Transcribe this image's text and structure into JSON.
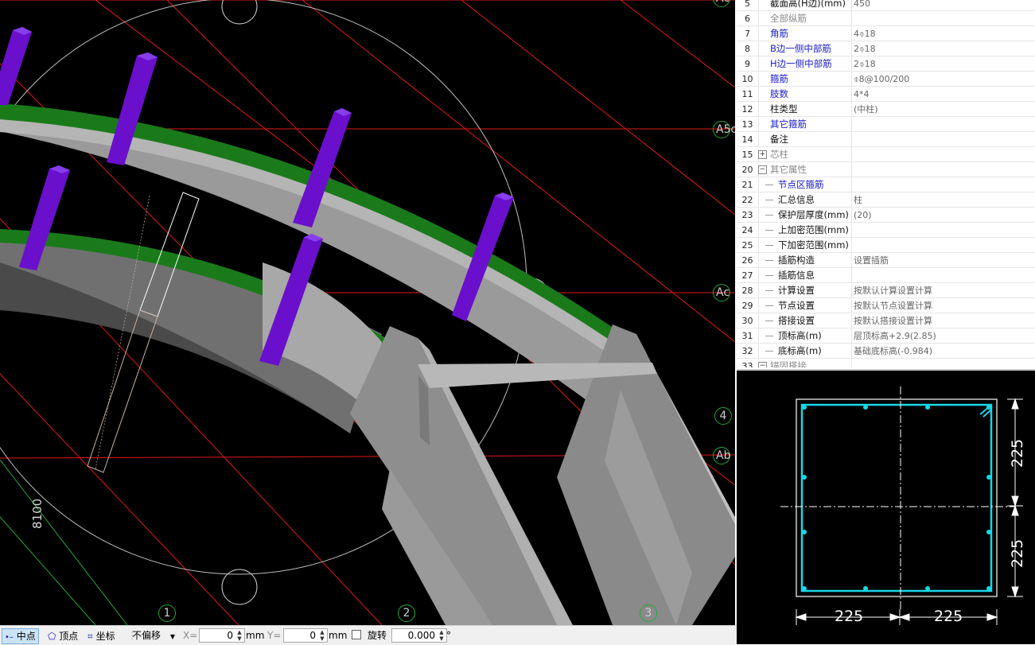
{
  "axis_labels": {
    "a5c": "A5c",
    "ac": "Ac",
    "ab": "Ab",
    "top_right": "Ac",
    "num_1": "1",
    "num_2": "2",
    "num_3": "3",
    "num_4": "4"
  },
  "dimension_text": "8100",
  "properties": [
    {
      "num": "5",
      "name": "截面高(H边)(mm)",
      "value": "450",
      "color": "black",
      "kind": "plain"
    },
    {
      "num": "6",
      "name": "全部纵筋",
      "value": "",
      "color": "gray",
      "kind": "plain"
    },
    {
      "num": "7",
      "name": "角筋",
      "value": "4⌽18",
      "color": "blue",
      "kind": "plain"
    },
    {
      "num": "8",
      "name": "B边一侧中部筋",
      "value": "2⌽18",
      "color": "blue",
      "kind": "plain"
    },
    {
      "num": "9",
      "name": "H边一侧中部筋",
      "value": "2⌽18",
      "color": "blue",
      "kind": "plain"
    },
    {
      "num": "10",
      "name": "箍筋",
      "value": "⌽8@100/200",
      "color": "blue",
      "kind": "plain"
    },
    {
      "num": "11",
      "name": "肢数",
      "value": "4*4",
      "color": "blue",
      "kind": "plain"
    },
    {
      "num": "12",
      "name": "柱类型",
      "value": "(中柱)",
      "color": "black",
      "kind": "plain"
    },
    {
      "num": "13",
      "name": "其它箍筋",
      "value": "",
      "color": "blue",
      "kind": "plain"
    },
    {
      "num": "14",
      "name": "备注",
      "value": "",
      "color": "black",
      "kind": "plain"
    },
    {
      "num": "15",
      "name": "芯柱",
      "value": "",
      "color": "gray",
      "kind": "group",
      "expander": "+"
    },
    {
      "num": "20",
      "name": "其它属性",
      "value": "",
      "color": "gray",
      "kind": "group",
      "expander": "−"
    },
    {
      "num": "21",
      "name": "节点区箍筋",
      "value": "",
      "color": "blue",
      "kind": "child"
    },
    {
      "num": "22",
      "name": "汇总信息",
      "value": "柱",
      "color": "black",
      "kind": "child"
    },
    {
      "num": "23",
      "name": "保护层厚度(mm)",
      "value": "(20)",
      "color": "black",
      "kind": "child"
    },
    {
      "num": "24",
      "name": "上加密范围(mm)",
      "value": "",
      "color": "black",
      "kind": "child"
    },
    {
      "num": "25",
      "name": "下加密范围(mm)",
      "value": "",
      "color": "black",
      "kind": "child"
    },
    {
      "num": "26",
      "name": "插筋构造",
      "value": "设置插筋",
      "color": "black",
      "kind": "child"
    },
    {
      "num": "27",
      "name": "插筋信息",
      "value": "",
      "color": "black",
      "kind": "child"
    },
    {
      "num": "28",
      "name": "计算设置",
      "value": "按默认计算设置计算",
      "color": "black",
      "kind": "child"
    },
    {
      "num": "29",
      "name": "节点设置",
      "value": "按默认节点设置计算",
      "color": "black",
      "kind": "child"
    },
    {
      "num": "30",
      "name": "搭接设置",
      "value": "按默认搭接设置计算",
      "color": "black",
      "kind": "child"
    },
    {
      "num": "31",
      "name": "顶标高(m)",
      "value": "层顶标高+2.9(2.85)",
      "color": "black",
      "kind": "child"
    },
    {
      "num": "32",
      "name": "底标高(m)",
      "value": "基础底标高(-0.984)",
      "color": "black",
      "kind": "child"
    },
    {
      "num": "33",
      "name": "锚固搭接",
      "value": "",
      "color": "gray",
      "kind": "group",
      "expander": "−"
    }
  ],
  "section": {
    "dim_top": "225",
    "dim_bottom_v": "225",
    "dim_left_h": "225",
    "dim_right_h": "225"
  },
  "statusbar": {
    "midpoint": "中点",
    "vertex": "顶点",
    "coordinate": "坐标",
    "offset_mode": "不偏移",
    "x_label": "X=",
    "x_value": "0",
    "x_unit": "mm",
    "y_label": "Y=",
    "y_value": "0",
    "y_unit": "mm",
    "rotate_label": "旋转",
    "rotate_value": "0.000",
    "degree": "°"
  },
  "colors": {
    "beam_top": "#1a7a1a",
    "column": "#6a0fcc",
    "wall": "#9a9a9a",
    "axis_line": "#ff1a1a",
    "rebar": "#18d8e8",
    "blue_text": "#1a1acc"
  }
}
